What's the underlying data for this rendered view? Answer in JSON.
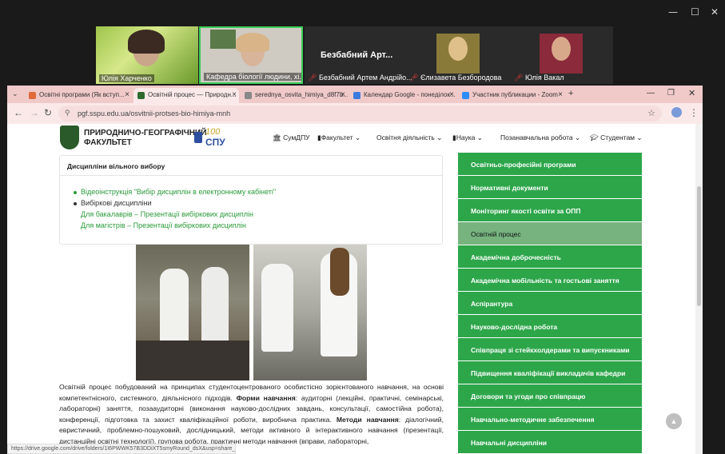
{
  "zoom": {
    "participants": [
      {
        "name": "Юлія Харченко",
        "muted": false
      },
      {
        "name": "Кафедра біології людини, хі...",
        "muted": false
      },
      {
        "name": "Безбабний  Арт...",
        "muted": true,
        "full": "Безбабний Артем Андрійо..."
      },
      {
        "name": "Єлизавета Безбородова",
        "muted": true
      },
      {
        "name": "Юлія Вакал",
        "muted": true
      }
    ],
    "window": {
      "min": "—",
      "max": "☐",
      "close": "✕"
    }
  },
  "browser": {
    "tabs": [
      {
        "label": "Освітні програми (Як вступ...",
        "color": "#e06a3a"
      },
      {
        "label": "Освітній процес — Природн...",
        "color": "#2e6b2e"
      },
      {
        "label": "serednya_osvita_himiya_d8f7b...",
        "color": "#888888"
      },
      {
        "label": "Календар Google - понеділок...",
        "color": "#3b7be0"
      },
      {
        "label": "Участник публикации - Zoom",
        "color": "#2d8cff"
      }
    ],
    "new_tab": "+",
    "url": "pgf.sspu.edu.ua/osvitnii-protses-bio-himiya-mnh",
    "status_url": "https://drive.google.com/drive/folders/1I6PWWK57B3DDiXT5smyRound_dsX&usp=share_link"
  },
  "site": {
    "logo_line1": "ПРИРОДНИЧО-ГЕОГРАФІЧНИЙ",
    "logo_line2": "ФАКУЛЬТЕТ",
    "spu_text": "СПУ",
    "spu_years": "100",
    "menu": [
      "СумДПУ",
      "Факультет",
      "Освітня діяльність",
      "Наука",
      "Позанавчальна робота",
      "Студентам"
    ]
  },
  "card": {
    "title": "Дисципліни вільного вибору",
    "items": [
      {
        "text": "Відеоінструкція \"Вибір дисциплін в електронному кабінеті\"",
        "type": "link"
      },
      {
        "text": "Вибіркові дисципліни",
        "type": "plain"
      },
      {
        "text": "Для бакалаврів – Презентації вибіркових дисциплін",
        "type": "link"
      },
      {
        "text": "Для магістрів – Презентації вибіркових дисциплін",
        "type": "link"
      }
    ]
  },
  "paragraph": {
    "p1": "Освітній процес побудований на принципах студентоцентрованого особистісно зорієнтованого навчання, на основі компетентнісного, системного, діяльнісного підходів.",
    "b1": "Форми навчання",
    "p2": ": аудиторні (лекційні, практичні, семінарські, лабораторні) заняття, позааудиторні (виконання науково-дослідних завдань, консультації, самостійна робота), конференції, підготовка та захист кваліфікаційної роботи, виробнича практика.",
    "b2": "Методи навчання",
    "p3": ": діалогічний, евристичний, проблемно-пошуковий, дослідницький, методи активного й інтерактивного навчання (презентації, дистанційні освітні технології), групова робота, практичні методи навчання (вправи, лабораторні,"
  },
  "sidebar": {
    "items": [
      "Освітньо-професійні програми",
      "Нормативні документи",
      "Моніторинг якості освіти за ОПП",
      "Освітній процес",
      "Академічна доброчесність",
      "Академічна мобільність та гостьові заняття",
      "Аспірантура",
      "Науково-дослідна робота",
      "Співпраця зі стейкхолдерами та випускниками",
      "Підвищення кваліфікації викладачів кафедри",
      "Договори та угоди про співпрацю",
      "Навчально-методичне забезпечення",
      "Навчальні дисципліни"
    ],
    "active_index": 3,
    "accent": "#2da64a"
  }
}
